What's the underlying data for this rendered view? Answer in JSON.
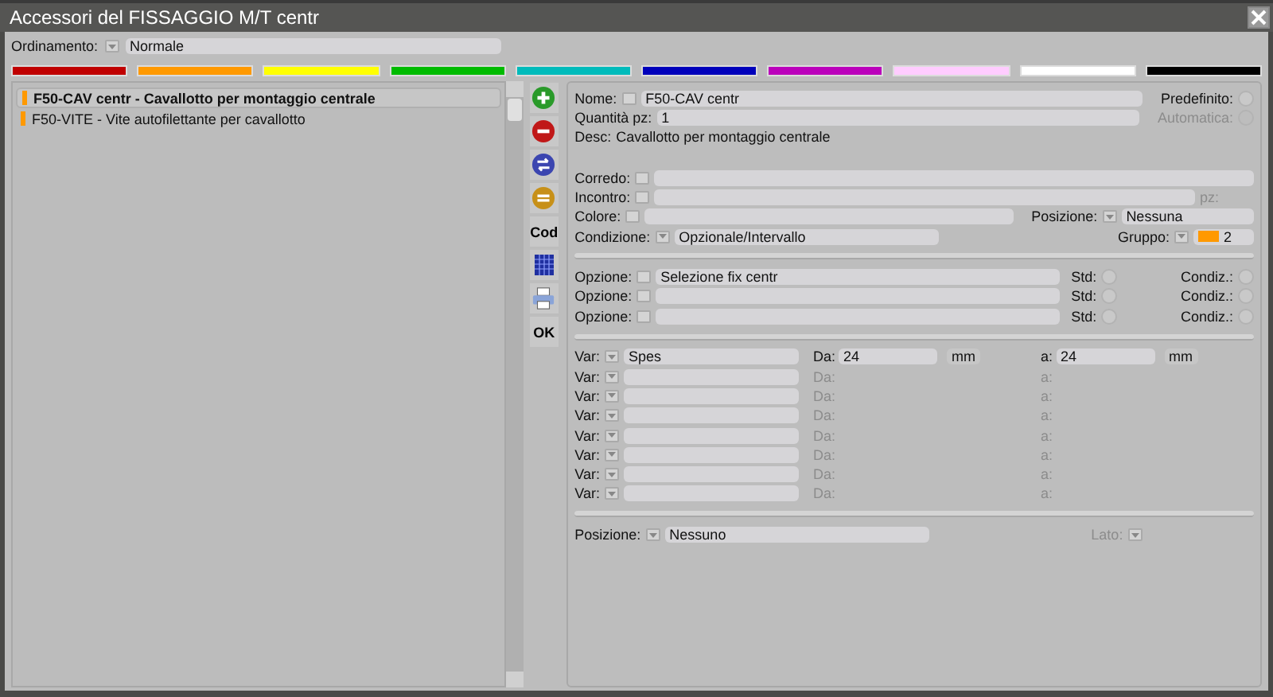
{
  "window": {
    "title": "Accessori del FISSAGGIO M/T centr"
  },
  "ordering": {
    "label": "Ordinamento:",
    "value": "Normale"
  },
  "color_filters": [
    {
      "color": "#c00000"
    },
    {
      "color": "#ff9900"
    },
    {
      "color": "#ffff00"
    },
    {
      "color": "#00bb00"
    },
    {
      "color": "#00bbbb"
    },
    {
      "color": "#0000bb"
    },
    {
      "color": "#bb00bb"
    },
    {
      "color": "#ffccff"
    },
    {
      "color": "#ffffff"
    },
    {
      "color": "#000000"
    }
  ],
  "list": {
    "items": [
      {
        "text": "F50-CAV centr - Cavallotto per montaggio centrale",
        "color": "#ff9900",
        "selected": true
      },
      {
        "text": "F50-VITE - Vite autofilettante per cavallotto",
        "color": "#ff9900",
        "selected": false
      }
    ]
  },
  "toolbar": [
    {
      "kind": "add"
    },
    {
      "kind": "remove"
    },
    {
      "kind": "swap"
    },
    {
      "kind": "equal"
    },
    {
      "kind": "text",
      "label": "Cod"
    },
    {
      "kind": "grid"
    },
    {
      "kind": "print"
    },
    {
      "kind": "text",
      "label": "OK"
    }
  ],
  "form": {
    "name": {
      "label": "Nome:",
      "value": "F50-CAV centr"
    },
    "default": {
      "label": "Predefinito:",
      "checked": false
    },
    "quantity": {
      "label": "Quantità pz:",
      "value": "1"
    },
    "automatic": {
      "label": "Automatica:",
      "checked": false,
      "disabled": true
    },
    "desc": {
      "label": "Desc:",
      "value": "Cavallotto per montaggio centrale"
    },
    "kit": {
      "label": "Corredo:"
    },
    "counterpart": {
      "label": "Incontro:",
      "unit": "pz:",
      "unit_disabled": true
    },
    "color": {
      "label": "Colore:"
    },
    "position": {
      "label": "Posizione:",
      "value": "Nessuna"
    },
    "condition": {
      "label": "Condizione:",
      "value": "Opzionale/Intervallo"
    },
    "group": {
      "label": "Gruppo:",
      "value": "2",
      "color": "#ff9900"
    },
    "options": [
      {
        "label": "Opzione:",
        "value": "Selezione fix centr",
        "std_label": "Std:",
        "std": false,
        "cond_label": "Condiz.:",
        "cond": false
      },
      {
        "label": "Opzione:",
        "std_label": "Std:",
        "std": false,
        "cond_label": "Condiz.:",
        "cond": false
      },
      {
        "label": "Opzione:",
        "std_label": "Std:",
        "std": false,
        "cond_label": "Condiz.:",
        "cond": false
      }
    ],
    "variables": [
      {
        "label": "Var:",
        "value": "Spes",
        "from_label": "Da:",
        "from": "24",
        "from_unit": "mm",
        "to_label": "a:",
        "to": "24",
        "to_unit": "mm",
        "enabled": true
      },
      {
        "label": "Var:",
        "from_label": "Da:",
        "to_label": "a:",
        "enabled": false
      },
      {
        "label": "Var:",
        "from_label": "Da:",
        "to_label": "a:",
        "enabled": false
      },
      {
        "label": "Var:",
        "from_label": "Da:",
        "to_label": "a:",
        "enabled": false
      },
      {
        "label": "Var:",
        "from_label": "Da:",
        "to_label": "a:",
        "enabled": false
      },
      {
        "label": "Var:",
        "from_label": "Da:",
        "to_label": "a:",
        "enabled": false
      },
      {
        "label": "Var:",
        "from_label": "Da:",
        "to_label": "a:",
        "enabled": false
      },
      {
        "label": "Var:",
        "from_label": "Da:",
        "to_label": "a:",
        "enabled": false
      }
    ],
    "placement": {
      "label": "Posizione:",
      "value": "Nessuno",
      "side_label": "Lato:",
      "side_disabled": true
    }
  }
}
